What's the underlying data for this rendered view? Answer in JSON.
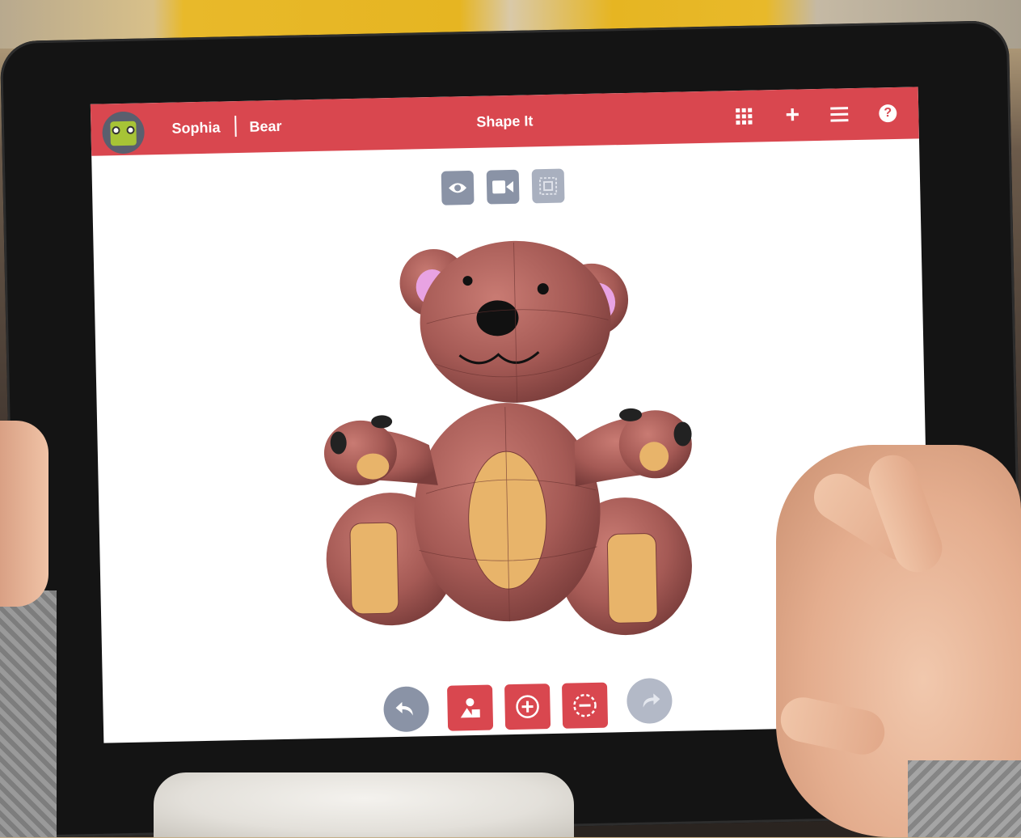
{
  "app": {
    "title": "Shape It",
    "user_name": "Sophia",
    "project_name": "Bear"
  },
  "header_icons": [
    "grid-icon",
    "plus-icon",
    "menu-icon",
    "help-icon"
  ],
  "header": {
    "plus_symbol": "+",
    "help_symbol": "?"
  },
  "view_controls": [
    "eye-icon",
    "camera-icon",
    "frame-icon"
  ],
  "bottom_toolbar": [
    "undo-icon",
    "shapes-icon",
    "add-icon",
    "subtract-icon",
    "redo-icon"
  ],
  "colors": {
    "brand_red": "#d9474f",
    "control_gray": "#8a93a6",
    "bear_body": "#a55a55",
    "bear_patch": "#e8b46a",
    "bear_ear": "#e8a3e3"
  }
}
